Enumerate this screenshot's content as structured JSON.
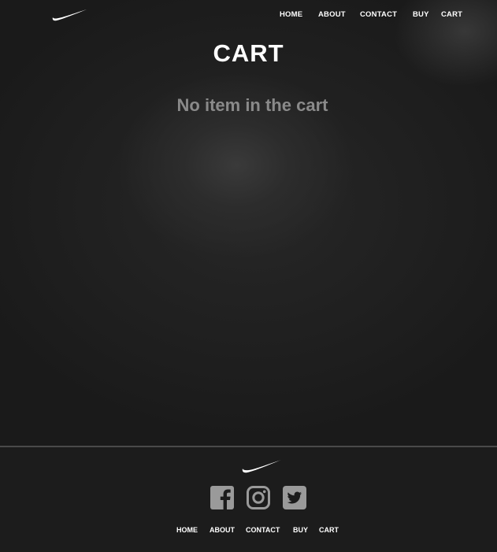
{
  "nav": {
    "logo_icon": "nike-swoosh-icon",
    "links": [
      {
        "label": "HOME"
      },
      {
        "label": "ABOUT"
      },
      {
        "label": "CONTACT"
      },
      {
        "label": "BUY"
      },
      {
        "label": "CART"
      }
    ]
  },
  "main": {
    "title": "CART",
    "empty_message": "No item in the cart"
  },
  "footer": {
    "logo_icon": "nike-swoosh-icon",
    "social": [
      {
        "icon": "facebook-icon"
      },
      {
        "icon": "instagram-icon"
      },
      {
        "icon": "twitter-icon"
      }
    ],
    "links": [
      {
        "label": "HOME"
      },
      {
        "label": "ABOUT"
      },
      {
        "label": "CONTACT"
      },
      {
        "label": "BUY"
      },
      {
        "label": "CART"
      }
    ]
  },
  "colors": {
    "background": "#1f1f1f",
    "text": "#ffffff",
    "muted_text": "#8a8a8a",
    "icon": "#9a9a9a",
    "divider": "#4a4a4a"
  }
}
